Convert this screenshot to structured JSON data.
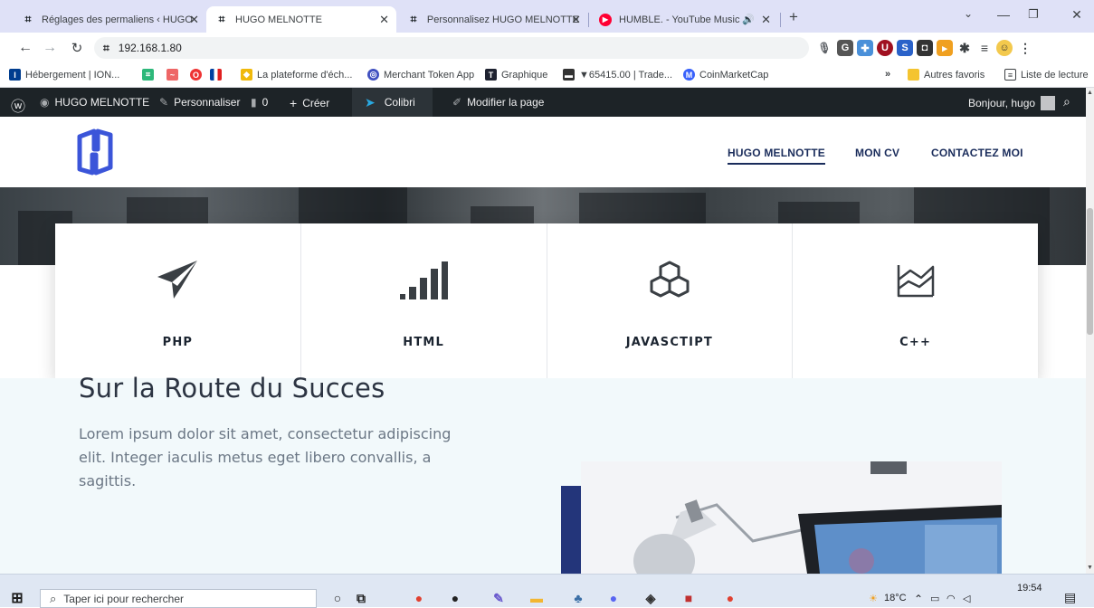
{
  "browser": {
    "tabs": [
      {
        "title": "Réglages des permaliens ‹ HUGO",
        "active": false
      },
      {
        "title": "HUGO MELNOTTE",
        "active": true
      },
      {
        "title": "Personnalisez HUGO MELNOTTE",
        "active": false
      },
      {
        "title": "HUMBLE. - YouTube Music",
        "active": false
      }
    ],
    "new_tab": "+",
    "address": "192.168.1.80",
    "bookmarks": [
      "Hébergement | ION...",
      "La plateforme d'éch...",
      "Merchant Token App",
      "Graphique",
      "▼65415.00 | Trade...",
      "CoinMarketCap"
    ],
    "bookmarks_overflow": "»",
    "other_favorites": "Autres favoris",
    "reading_list": "Liste de lecture"
  },
  "wp_admin_bar": {
    "site_name": "HUGO MELNOTTE",
    "customize": "Personnaliser",
    "comments_count": "0",
    "create": "Créer",
    "colibri": "Colibri",
    "edit_page": "Modifier la page",
    "greeting": "Bonjour, hugo"
  },
  "site": {
    "nav": [
      "HUGO MELNOTTE",
      "MON CV",
      "CONTACTEZ MOI"
    ],
    "active_nav": "HUGO MELNOTTE",
    "cards": [
      {
        "label": "PHP",
        "icon": "paper-plane-icon"
      },
      {
        "label": "HTML",
        "icon": "signal-bars-icon"
      },
      {
        "label": "JAVASCTIPT",
        "icon": "cubes-icon"
      },
      {
        "label": "C++",
        "icon": "area-chart-icon"
      }
    ],
    "about_title": "Sur la Route du Succes",
    "about_text": "Lorem ipsum dolor sit amet, consectetur adipiscing elit. Integer iaculis metus eget libero convallis, a sagittis."
  },
  "taskbar": {
    "search_placeholder": "Taper ici pour rechercher",
    "temperature": "18°C",
    "time": "19:54"
  },
  "colors": {
    "brand_navy": "#1a2c5b",
    "logo_blue": "#3b55d9",
    "wp_bar": "#1d2327",
    "about_bg": "#f2f9fb"
  }
}
